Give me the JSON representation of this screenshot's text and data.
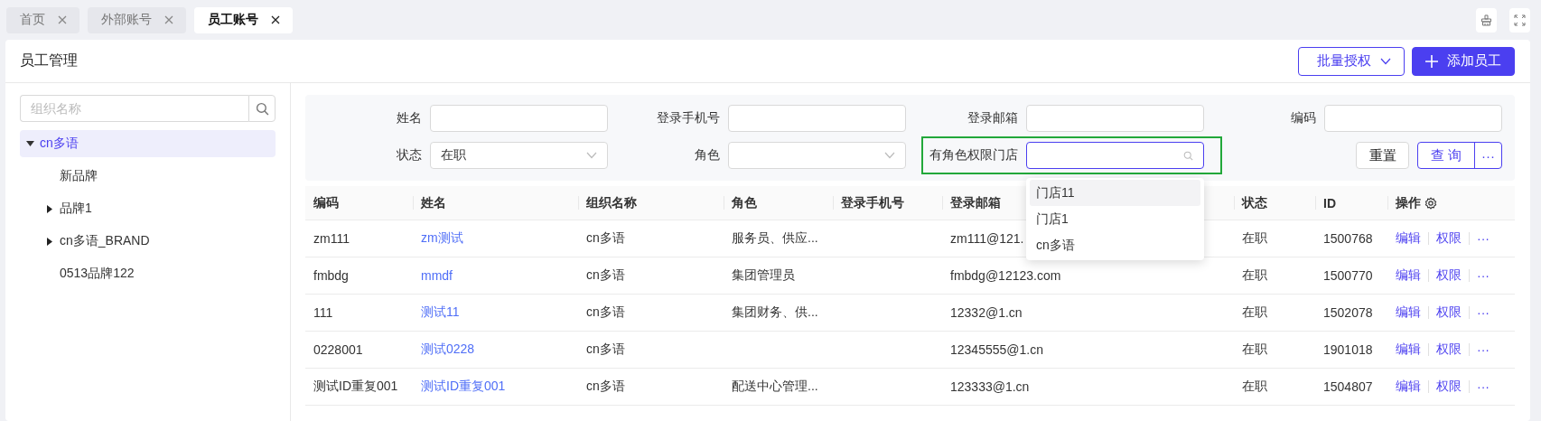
{
  "tabs": [
    {
      "label": "首页",
      "selected": false
    },
    {
      "label": "外部账号",
      "selected": false
    },
    {
      "label": "员工账号",
      "selected": true
    }
  ],
  "header": {
    "title": "员工管理",
    "buttons": [
      {
        "kind": "dropdown",
        "label": "批量授权"
      },
      {
        "kind": "primary",
        "label": "添加员工"
      }
    ]
  },
  "sidebar": {
    "search": {
      "placeholder": "组织名称"
    },
    "tree": [
      {
        "label": "cn多语",
        "selected": true,
        "expanded": true,
        "children": [
          {
            "label": "新品牌",
            "selected": false
          },
          {
            "label": "品牌1",
            "selected": false,
            "expanded": false
          },
          {
            "label": "cn多语_BRAND",
            "selected": false,
            "expanded": false
          },
          {
            "label": "0513品牌122",
            "selected": false
          }
        ]
      }
    ]
  },
  "filters": [
    {
      "kind": "input",
      "label": "姓名"
    },
    {
      "kind": "input",
      "label": "登录手机号"
    },
    {
      "kind": "input",
      "label": "登录邮箱"
    },
    {
      "kind": "input",
      "label": "编码"
    },
    {
      "kind": "select",
      "label": "状态",
      "value": "在职"
    },
    {
      "kind": "select",
      "label": "角色"
    },
    {
      "kind": "search",
      "label": "有角色权限门店",
      "focused": true,
      "highlighted": true,
      "options": [
        {
          "label": "门店11",
          "active": true
        },
        {
          "label": "门店1",
          "active": false
        },
        {
          "label": "cn多语",
          "active": false
        }
      ]
    }
  ],
  "filter_actions": [
    {
      "kind": "reset",
      "label": "重置"
    },
    {
      "kind": "query",
      "label": "查 询"
    },
    {
      "kind": "more",
      "label": "···"
    }
  ],
  "table": {
    "columns": [
      {
        "label": "编码",
        "kind": "text"
      },
      {
        "label": "姓名",
        "kind": "link"
      },
      {
        "label": "组织名称",
        "kind": "text"
      },
      {
        "label": "角色",
        "kind": "text"
      },
      {
        "label": "登录手机号",
        "kind": "text"
      },
      {
        "label": "登录邮箱",
        "kind": "text"
      },
      {
        "label": "状态",
        "kind": "text"
      },
      {
        "label": "ID",
        "kind": "text"
      },
      {
        "label": "操作",
        "kind": "actions"
      }
    ],
    "rows": [
      {
        "cells": [
          "zm111",
          "zm测试",
          "cn多语",
          "服务员、供应...",
          null,
          "zm111@121.",
          "在职",
          "1500768"
        ],
        "actions": [
          "编辑",
          "权限",
          "···"
        ]
      },
      {
        "cells": [
          "fmbdg",
          "mmdf",
          "cn多语",
          "集团管理员",
          null,
          "fmbdg@12123.com",
          "在职",
          "1500770"
        ],
        "actions": [
          "编辑",
          "权限",
          "···"
        ]
      },
      {
        "cells": [
          "111",
          "测试11",
          "cn多语",
          "集团财务、供...",
          null,
          "12332@1.cn",
          "在职",
          "1502078"
        ],
        "actions": [
          "编辑",
          "权限",
          "···"
        ]
      },
      {
        "cells": [
          "0228001",
          "测试0228",
          "cn多语",
          null,
          null,
          "12345555@1.cn",
          "在职",
          "1901018"
        ],
        "actions": [
          "编辑",
          "权限",
          "···"
        ]
      },
      {
        "cells": [
          "测试ID重复001",
          "测试ID重复001",
          "cn多语",
          "配送中心管理...",
          null,
          "123333@1.cn",
          "在职",
          "1504807"
        ],
        "actions": [
          "编辑",
          "权限",
          "···"
        ]
      }
    ]
  }
}
